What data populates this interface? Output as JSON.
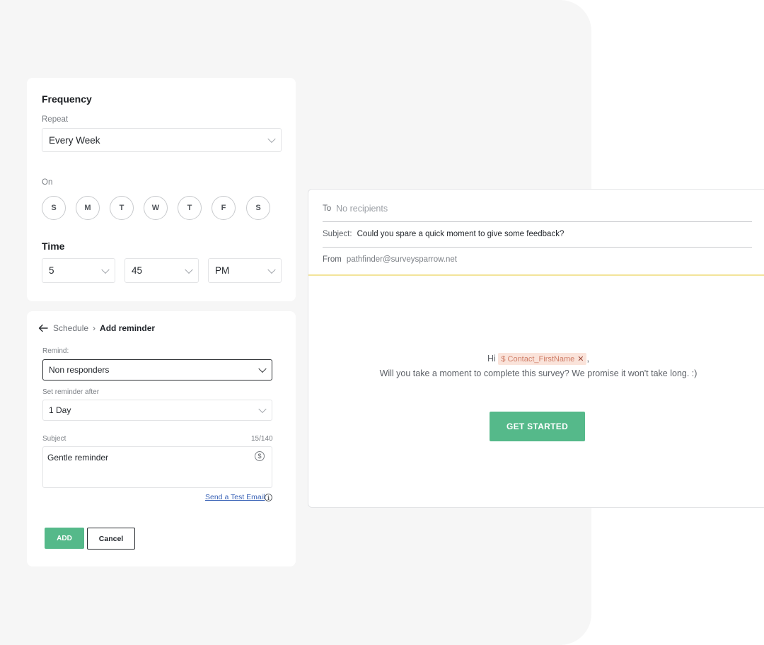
{
  "frequency": {
    "title": "Frequency",
    "repeat_label": "Repeat",
    "repeat_value": "Every Week",
    "on_label": "On",
    "days": [
      "S",
      "M",
      "T",
      "W",
      "T",
      "F",
      "S"
    ],
    "time_title": "Time",
    "hour": "5",
    "minute": "45",
    "ampm": "PM"
  },
  "reminder": {
    "breadcrumb_parent": "Schedule",
    "breadcrumb_current": "Add reminder",
    "remind_label": "Remind:",
    "remind_value": "Non responders",
    "after_label": "Set reminder after",
    "after_value": "1 Day",
    "subject_label": "Subject",
    "subject_count": "15/140",
    "subject_value": "Gentle reminder",
    "dollar_icon": "$",
    "test_email_link": "Send a Test Email",
    "info_icon": "i",
    "add_button": "ADD",
    "cancel_button": "Cancel"
  },
  "email": {
    "to_label": "To",
    "to_value": "No recipients",
    "subject_label": "Subject:",
    "subject_value": "Could you spare a quick moment to give some feedback?",
    "from_label": "From",
    "from_value": "pathfinder@surveysparrow.net",
    "greeting_hi": "Hi",
    "token_label": "$ Contact_FirstName",
    "token_remove": "✕",
    "greeting_comma": ",",
    "body_text": "Will you take a moment to complete this survey? We promise it won't take long. :)",
    "cta_label": "GET STARTED"
  },
  "colors": {
    "accent_green": "#55b98a",
    "token_bg": "#fae3da",
    "divider_yellow": "#f3e49a"
  }
}
